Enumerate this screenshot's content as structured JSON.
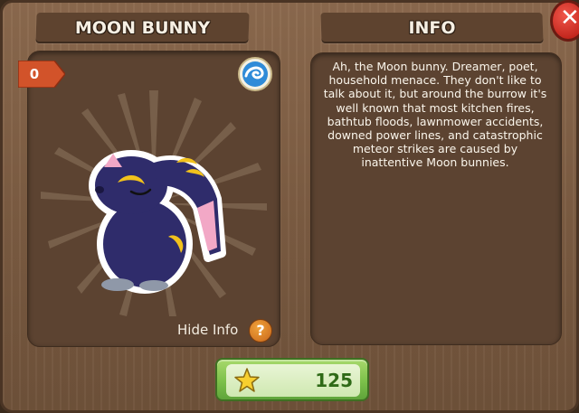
{
  "window": {
    "title_left": "MOON BUNNY",
    "title_right": "INFO"
  },
  "item": {
    "count_badge": "0",
    "element_icon": "water-swirl-icon",
    "hide_info_label": "Hide Info",
    "help_icon": "question-icon"
  },
  "info": {
    "description": "Ah, the Moon bunny.  Dreamer, poet, household menace.  They don't like to talk about it, but around the burrow it's well known that most kitchen fires, bathtub floods, lawnmower accidents, downed power lines, and catastrophic meteor strikes are caused by inattentive Moon bunnies."
  },
  "purchase": {
    "currency_icon": "star-icon",
    "price": "125"
  },
  "colors": {
    "wood": "#7d5d43",
    "panel": "#5c4331",
    "badge": "#d2532a",
    "close": "#d9342a",
    "buy": "#7cc04a",
    "price_text": "#2f6a17",
    "bunny_body": "#2f2c6b",
    "moon_yellow": "#f2c21c"
  }
}
